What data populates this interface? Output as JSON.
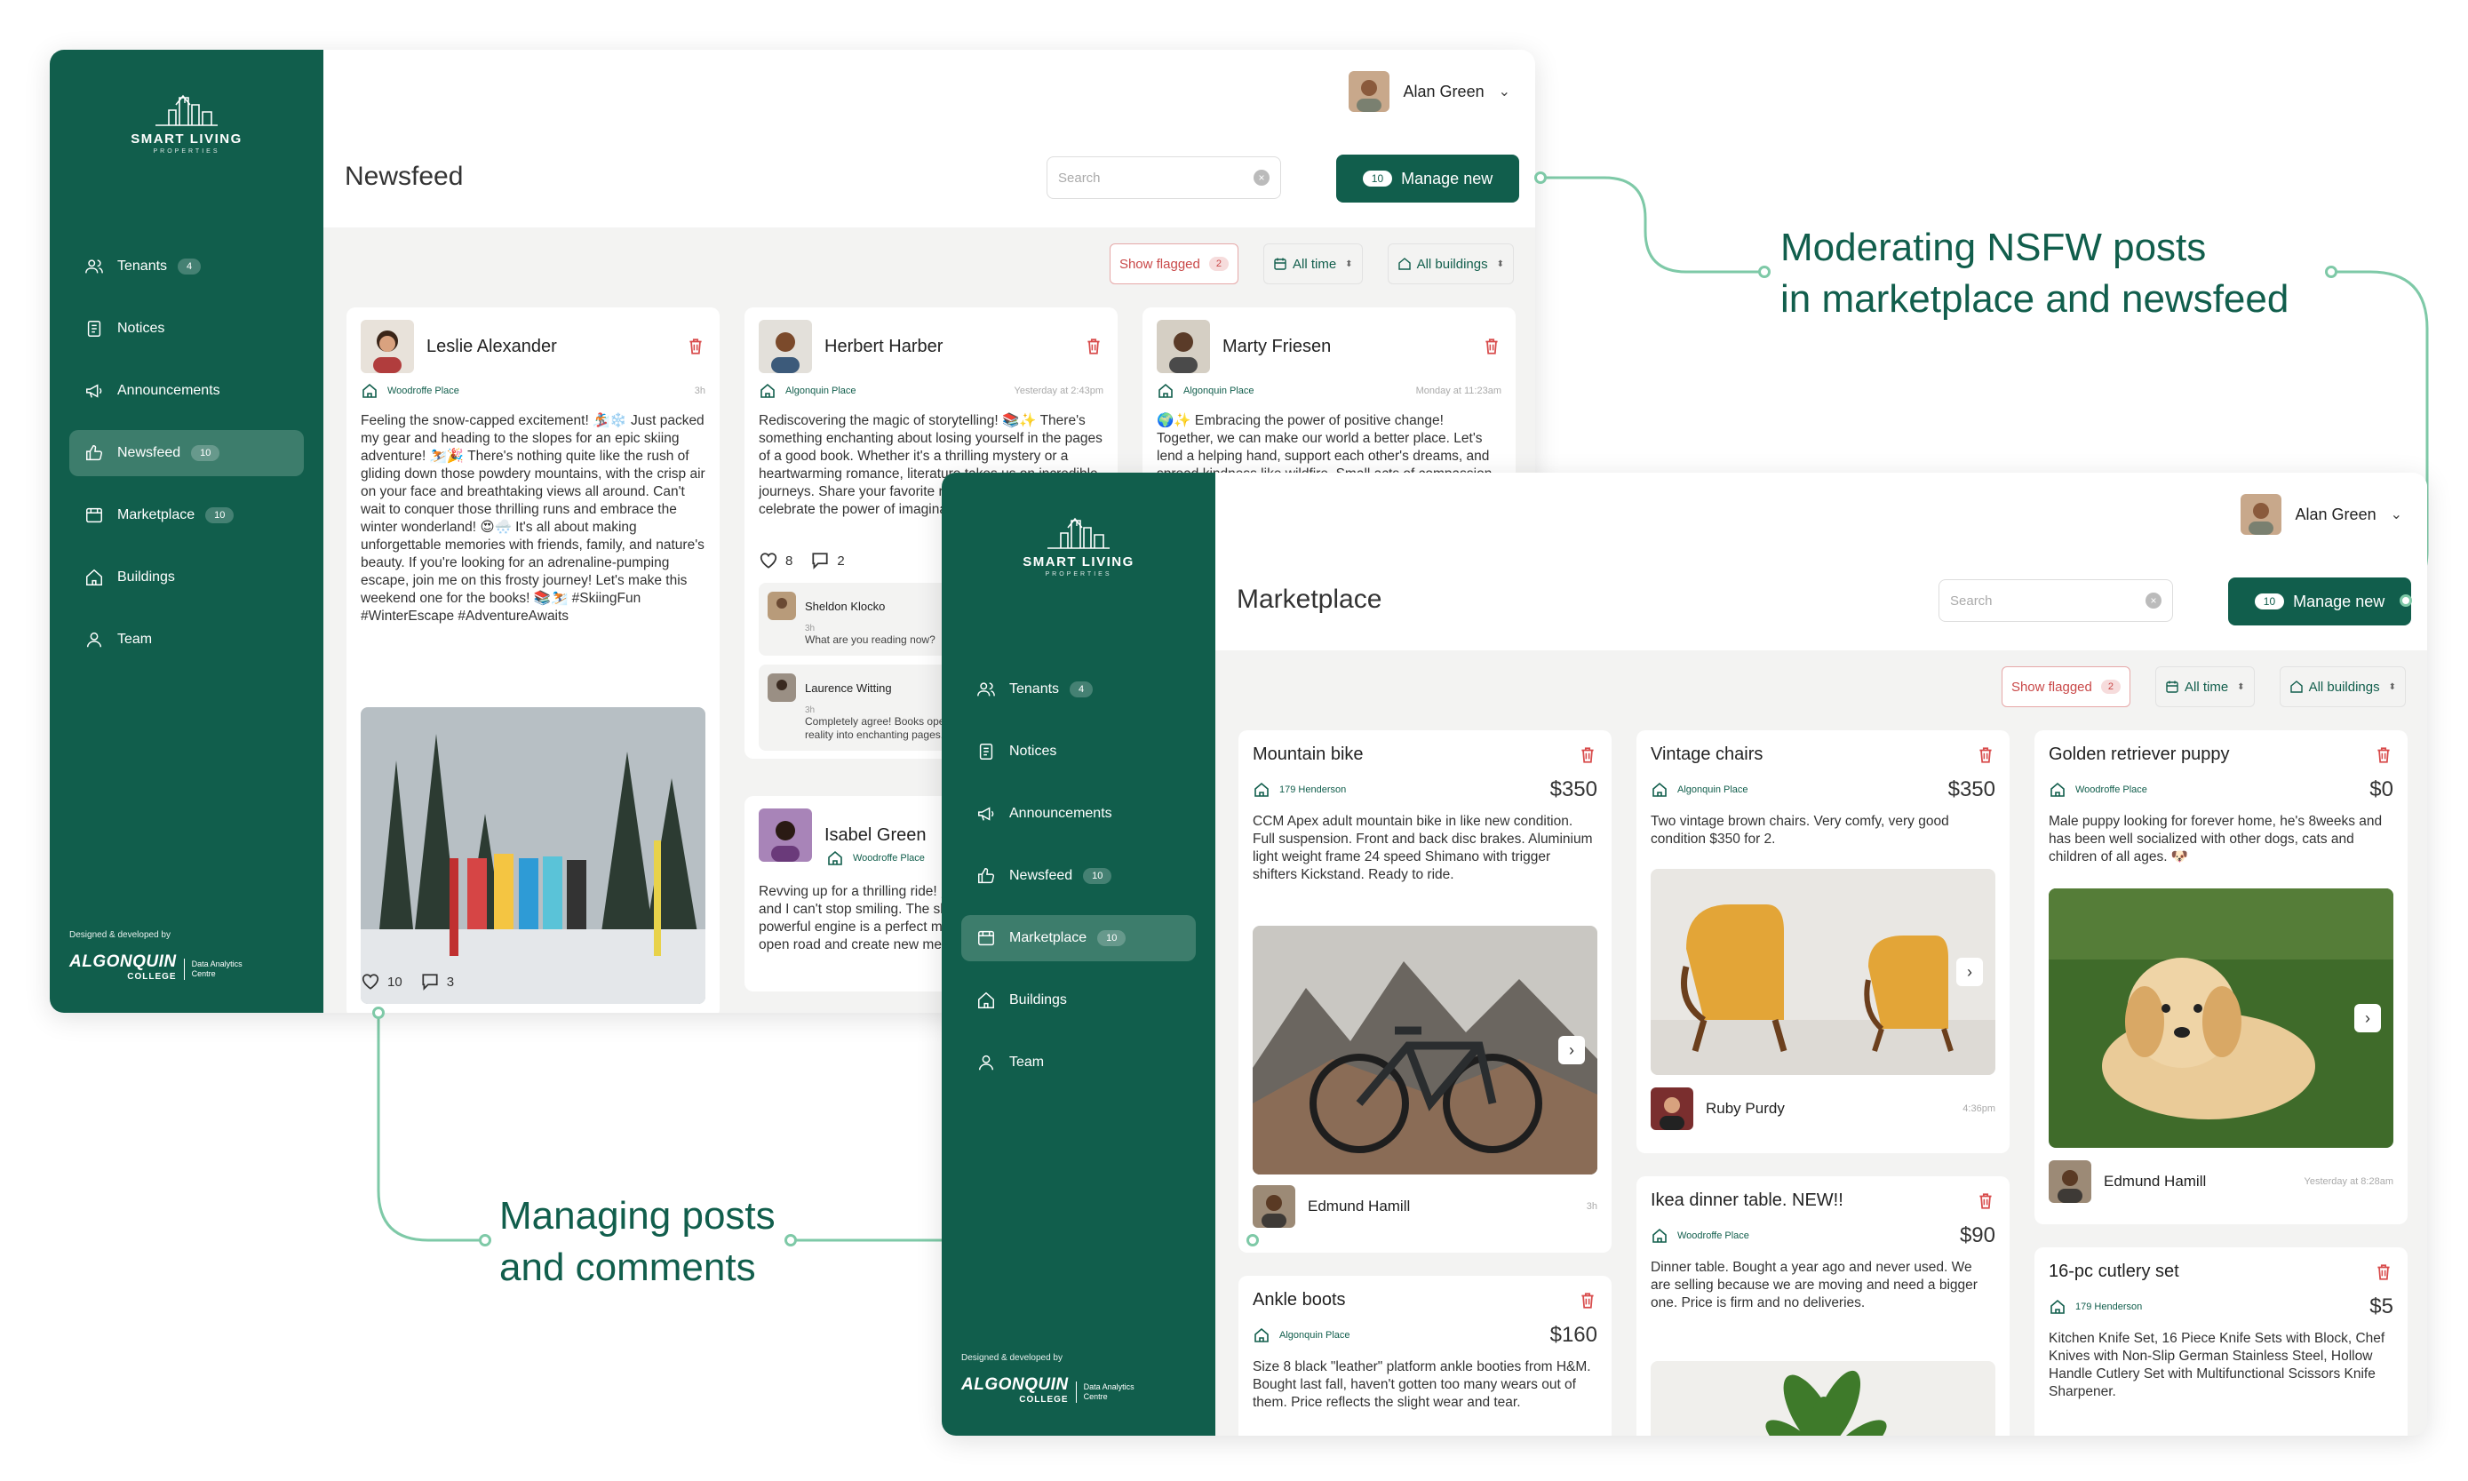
{
  "annotations": {
    "moderating_line1": "Moderating NSFW posts",
    "moderating_line2": "in marketplace and newsfeed",
    "managing_line1": "Managing posts",
    "managing_line2": "and comments"
  },
  "colors": {
    "brand": "#115e4c",
    "active_nav": "#3d7d6c",
    "flag": "#c94848",
    "connector": "#7ec9a7"
  },
  "common": {
    "logo_text": "SMART LIVING",
    "logo_sub": "PROPERTIES",
    "user_name": "Alan Green",
    "search_placeholder": "Search",
    "manage_count": "10",
    "manage_label": "Manage new",
    "show_flagged": "Show flagged",
    "flagged_count": "2",
    "all_time": "All time",
    "all_buildings": "All buildings",
    "credit": "Designed & developed by",
    "brand_main": "ALGONQUIN",
    "brand_college": "COLLEGE",
    "brand_sub1": "Data Analytics",
    "brand_sub2": "Centre",
    "nav": [
      {
        "label": "Tenants",
        "badge": "4",
        "icon": "users-icon"
      },
      {
        "label": "Notices",
        "badge": "",
        "icon": "notice-icon"
      },
      {
        "label": "Announcements",
        "badge": "",
        "icon": "megaphone-icon"
      },
      {
        "label": "Newsfeed",
        "badge": "10",
        "icon": "thumbs-up-icon"
      },
      {
        "label": "Marketplace",
        "badge": "10",
        "icon": "store-icon"
      },
      {
        "label": "Buildings",
        "badge": "",
        "icon": "home-icon"
      },
      {
        "label": "Team",
        "badge": "",
        "icon": "person-icon"
      }
    ]
  },
  "newsfeed": {
    "title": "Newsfeed",
    "posts": [
      {
        "author": "Leslie Alexander",
        "location": "Woodroffe Place",
        "time": "3h",
        "text": "Feeling the snow-capped excitement! 🏂❄️ Just packed my gear and heading to the slopes for an epic skiing adventure! ⛷️🎉 There's nothing quite like the rush of gliding down those powdery mountains, with the crisp air on your face and breathtaking views all around. Can't wait to conquer those thrilling runs and embrace the winter wonderland! 😍🌨️ It's all about making unforgettable memories with friends, family, and nature's beauty. If you're looking for an adrenaline-pumping escape, join me on this frosty journey! Let's make this weekend one for the books! 📚⛷️ #SkiingFun #WinterEscape #AdventureAwaits",
        "likes": "10",
        "comments": "3"
      },
      {
        "author": "Herbert Harber",
        "location": "Algonquin Place",
        "time": "Yesterday at 2:43pm",
        "text": "Rediscovering the magic of storytelling! 📚✨ There's something enchanting about losing yourself in the pages of a good book. Whether it's a thrilling mystery or a heartwarming romance, literature takes us on incredible journeys. Share your favorite reads below and let's celebrate the power of imagination together!",
        "likes": "8",
        "comments": "2",
        "replies": [
          {
            "name": "Sheldon Klocko",
            "time": "3h",
            "text": "What are you reading now?"
          },
          {
            "name": "Laurence Witting",
            "time": "3h",
            "text": "Completely agree! Books open new worlds. I love escaping reality into enchanting pages."
          }
        ]
      },
      {
        "author": "Marty Friesen",
        "location": "Algonquin Place",
        "time": "Monday at 11:23am",
        "text": "🌍✨ Embracing the power of positive change! Together, we can make our world a better place. Let's lend a helping hand, support each other's dreams, and spread kindness like wildfire. Small acts of compassion can ripple into big"
      },
      {
        "author": "Isabel Green",
        "location": "Woodroffe Place",
        "time": "",
        "text": "Revving up for a thrilling ride! 🏎️ I just got a new car and I can't stop smiling. The sleek design to the powerful engine is a perfect match. Ready to hit the open road and create new memories!"
      }
    ]
  },
  "marketplace": {
    "title": "Marketplace",
    "listings": [
      {
        "title": "Mountain bike",
        "location": "179 Henderson",
        "price": "$350",
        "desc": "CCM Apex adult mountain bike in like new condition. Full suspension. Front and back disc brakes. Aluminium light weight frame 24 speed Shimano with trigger shifters Kickstand. Ready to ride.",
        "seller": "Edmund Hamill",
        "time": "3h"
      },
      {
        "title": "Vintage chairs",
        "location": "Algonquin Place",
        "price": "$350",
        "desc": "Two vintage brown chairs. Very comfy, very good condition $350 for 2.",
        "seller": "Ruby Purdy",
        "time": "4:36pm"
      },
      {
        "title": "Golden retriever puppy",
        "location": "Woodroffe Place",
        "price": "$0",
        "desc": "Male puppy looking for forever home, he's 8weeks and has been well socialized with other dogs, cats and children of all ages. 🐶",
        "seller": "Edmund Hamill",
        "time": "Yesterday at 8:28am"
      },
      {
        "title": "Ankle boots",
        "location": "Algonquin Place",
        "price": "$160",
        "desc": "Size 8 black \"leather\" platform ankle booties from H&M. Bought last fall, haven't gotten too many wears out of them. Price reflects the slight wear and tear."
      },
      {
        "title": "Ikea dinner table. NEW!!",
        "location": "Woodroffe Place",
        "price": "$90",
        "desc": "Dinner table. Bought a year ago and never used. We are selling because we are moving and need a bigger one. Price is firm and no deliveries."
      },
      {
        "title": "16-pc cutlery set",
        "location": "179 Henderson",
        "price": "$5",
        "desc": "Kitchen Knife Set, 16 Piece Knife Sets with Block, Chef Knives with Non-Slip German Stainless Steel, Hollow Handle Cutlery Set with Multifunctional Scissors Knife Sharpener."
      }
    ]
  }
}
